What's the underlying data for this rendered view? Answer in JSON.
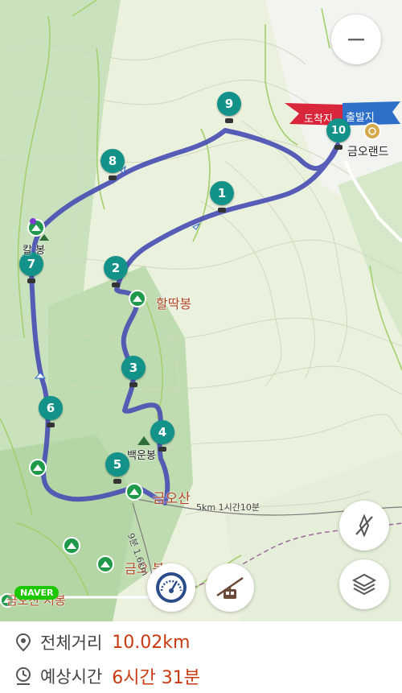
{
  "map": {
    "waypoints": [
      {
        "number": "1"
      },
      {
        "number": "2"
      },
      {
        "number": "3"
      },
      {
        "number": "4"
      },
      {
        "number": "5"
      },
      {
        "number": "6"
      },
      {
        "number": "7"
      },
      {
        "number": "8"
      },
      {
        "number": "9"
      },
      {
        "number": "10"
      }
    ],
    "flags": {
      "arrival": "도착지",
      "departure": "출발지"
    },
    "labels": {
      "geumoland": "금오랜드",
      "halttakbong": "할딱봉",
      "baegunbong": "백운봉",
      "geumosan": "금오산",
      "geumo_west_peak": "금오산 서봉",
      "geumo_peak_partial": "금오 봉",
      "peak7_partial": "칼 봉",
      "trail_distance": "5km 1시간10분",
      "trail_dist_partial": "9분 1.6km",
      "naver": "NAVER"
    },
    "colors": {
      "route": "#4a4fb3",
      "marker": "#13928a",
      "arrival_flag": "#d9263a",
      "departure_flag": "#2d6fc9",
      "accent_text": "#c83a12"
    }
  },
  "controls": {
    "zoom_out_icon": "minus-icon",
    "compass_off_icon": "compass-off-icon",
    "layers_icon": "layers-icon",
    "speedometer_icon": "speedometer-icon",
    "cablecar_icon": "cable-car-icon"
  },
  "summary": {
    "total_distance_label": "전체거리",
    "total_distance_value": "10.02km",
    "estimated_time_label": "예상시간",
    "estimated_time_value": "6시간 31분"
  }
}
